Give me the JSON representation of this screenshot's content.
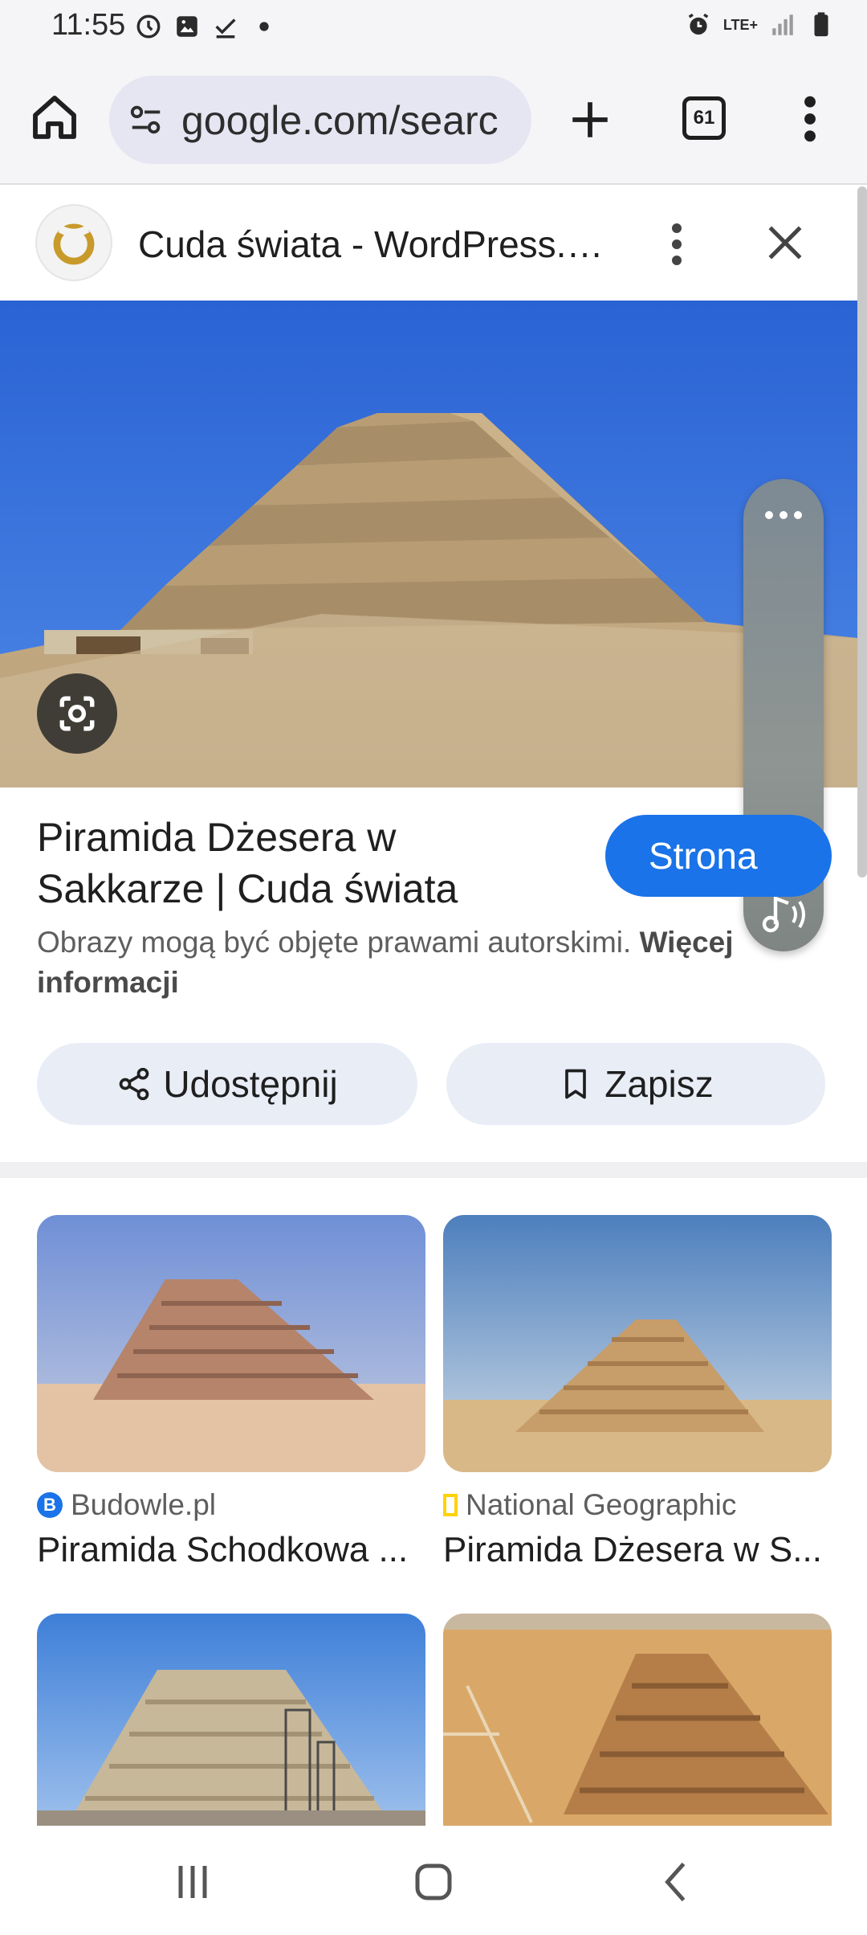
{
  "status_bar": {
    "time": "11:55",
    "icons_left": [
      "clock-icon",
      "image-icon",
      "check-icon",
      "dot-icon"
    ],
    "icons_right": [
      "alarm-icon",
      "lte-icon",
      "signal-icon",
      "battery-icon"
    ],
    "network": "LTE+"
  },
  "toolbar": {
    "url": "google.com/searc",
    "tab_count": "61"
  },
  "source": {
    "title": "Cuda świata - WordPress.c..."
  },
  "result": {
    "title": "Piramida Dżesera w Sakkarze | Cuda świata",
    "visit_label": "Strona",
    "copyright_text": "Obrazy mogą być objęte prawami autorskimi.",
    "copyright_link": "Więcej informacji",
    "share_label": "Udostępnij",
    "save_label": "Zapisz"
  },
  "related": [
    {
      "source": "Budowle.pl",
      "favicon_letter": "B",
      "favicon_color": "#1a73e8",
      "title": "Piramida Schodkowa ..."
    },
    {
      "source": "National Geographic",
      "favicon_letter": "",
      "favicon_color": "#ffd200",
      "title": "Piramida Dżesera w S..."
    },
    {
      "source": "",
      "title": ""
    },
    {
      "source": "",
      "title": ""
    }
  ],
  "colors": {
    "accent": "#1a73e8",
    "chip_bg": "#e8edf6",
    "url_bg": "#e6e5f2",
    "sky": "#2f6fdc",
    "sand": "#d6b98a"
  }
}
